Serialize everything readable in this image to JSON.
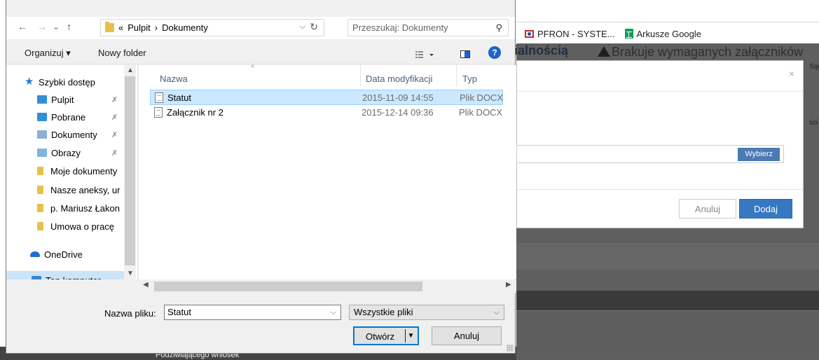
{
  "background_page": {
    "bookmarks": [
      {
        "label": "PFRON - SYSTE...",
        "icon": "pfron-icon"
      },
      {
        "label": "Arkusze Google",
        "icon": "google-sheets-icon"
      }
    ],
    "heading_fragment": "ialnością",
    "warning_text": "Brakuje wymaganych załączników",
    "edge_text_1": "Sąc",
    "edge_text_2": "ści",
    "modal": {
      "close": "×",
      "choose_button": "Wybierz",
      "cancel_button": "Anuluj",
      "add_button": "Dodaj"
    },
    "bottom_fragment": "Podziwiającego wniosek"
  },
  "dialog": {
    "nav_back": "←",
    "nav_forward": "→",
    "nav_recent": "⌄",
    "nav_up": "↑",
    "address": {
      "overflow": "«",
      "crumbs": [
        "Pulpit",
        "Dokumenty"
      ],
      "separator": "›"
    },
    "search_placeholder": "Przeszukaj: Dokumenty",
    "toolbar": {
      "organize": "Organizuj ▾",
      "new_folder": "Nowy folder"
    },
    "sidebar": [
      {
        "label": "Szybki dostęp",
        "icon": "quick-access-star-icon",
        "color": "#1e7fd8",
        "pinned": false
      },
      {
        "label": "Pulpit",
        "icon": "desktop-folder-icon",
        "color": "#2f8fd6",
        "pinned": true
      },
      {
        "label": "Pobrane",
        "icon": "downloads-folder-icon",
        "color": "#2f8fd6",
        "pinned": true
      },
      {
        "label": "Dokumenty",
        "icon": "documents-folder-icon",
        "color": "#8cb0d8",
        "pinned": true
      },
      {
        "label": "Obrazy",
        "icon": "pictures-folder-icon",
        "color": "#7fb5e0",
        "pinned": true
      },
      {
        "label": "Moje dokumenty",
        "icon": "folder-icon",
        "color": "#e8bf4a",
        "pinned": false
      },
      {
        "label": "Nasze aneksy, ur",
        "icon": "folder-icon",
        "color": "#e8bf4a",
        "pinned": false
      },
      {
        "label": "p. Mariusz Łakon",
        "icon": "folder-icon",
        "color": "#e8bf4a",
        "pinned": false
      },
      {
        "label": "Umowa o pracę",
        "icon": "folder-icon",
        "color": "#e8bf4a",
        "pinned": false
      },
      {
        "label": "OneDrive",
        "icon": "onedrive-cloud-icon",
        "color": "#1e6fd0",
        "pinned": false
      },
      {
        "label": "Ten komputer",
        "icon": "this-pc-icon",
        "color": "#3a86d4",
        "pinned": false
      }
    ],
    "pin_glyph": "✗",
    "columns": [
      "Nazwa",
      "Data modyfikacji",
      "Typ"
    ],
    "files": [
      {
        "name": "Statut",
        "modified": "2015-11-09 14:55",
        "type": "Plik DOCX",
        "selected": true
      },
      {
        "name": "Załącznik nr 2",
        "modified": "2015-12-14 09:36",
        "type": "Plik DOCX",
        "selected": false
      }
    ],
    "filename_label": "Nazwa pliku:",
    "filename_value": "Statut",
    "filetype_value": "Wszystkie pliki",
    "open_button": "Otwórz",
    "cancel_button": "Anuluj",
    "help": "?",
    "dropdown_glyph": "⌵",
    "refresh_glyph": "↻",
    "search_glyph": "⚲",
    "sort_glyph": "^"
  }
}
